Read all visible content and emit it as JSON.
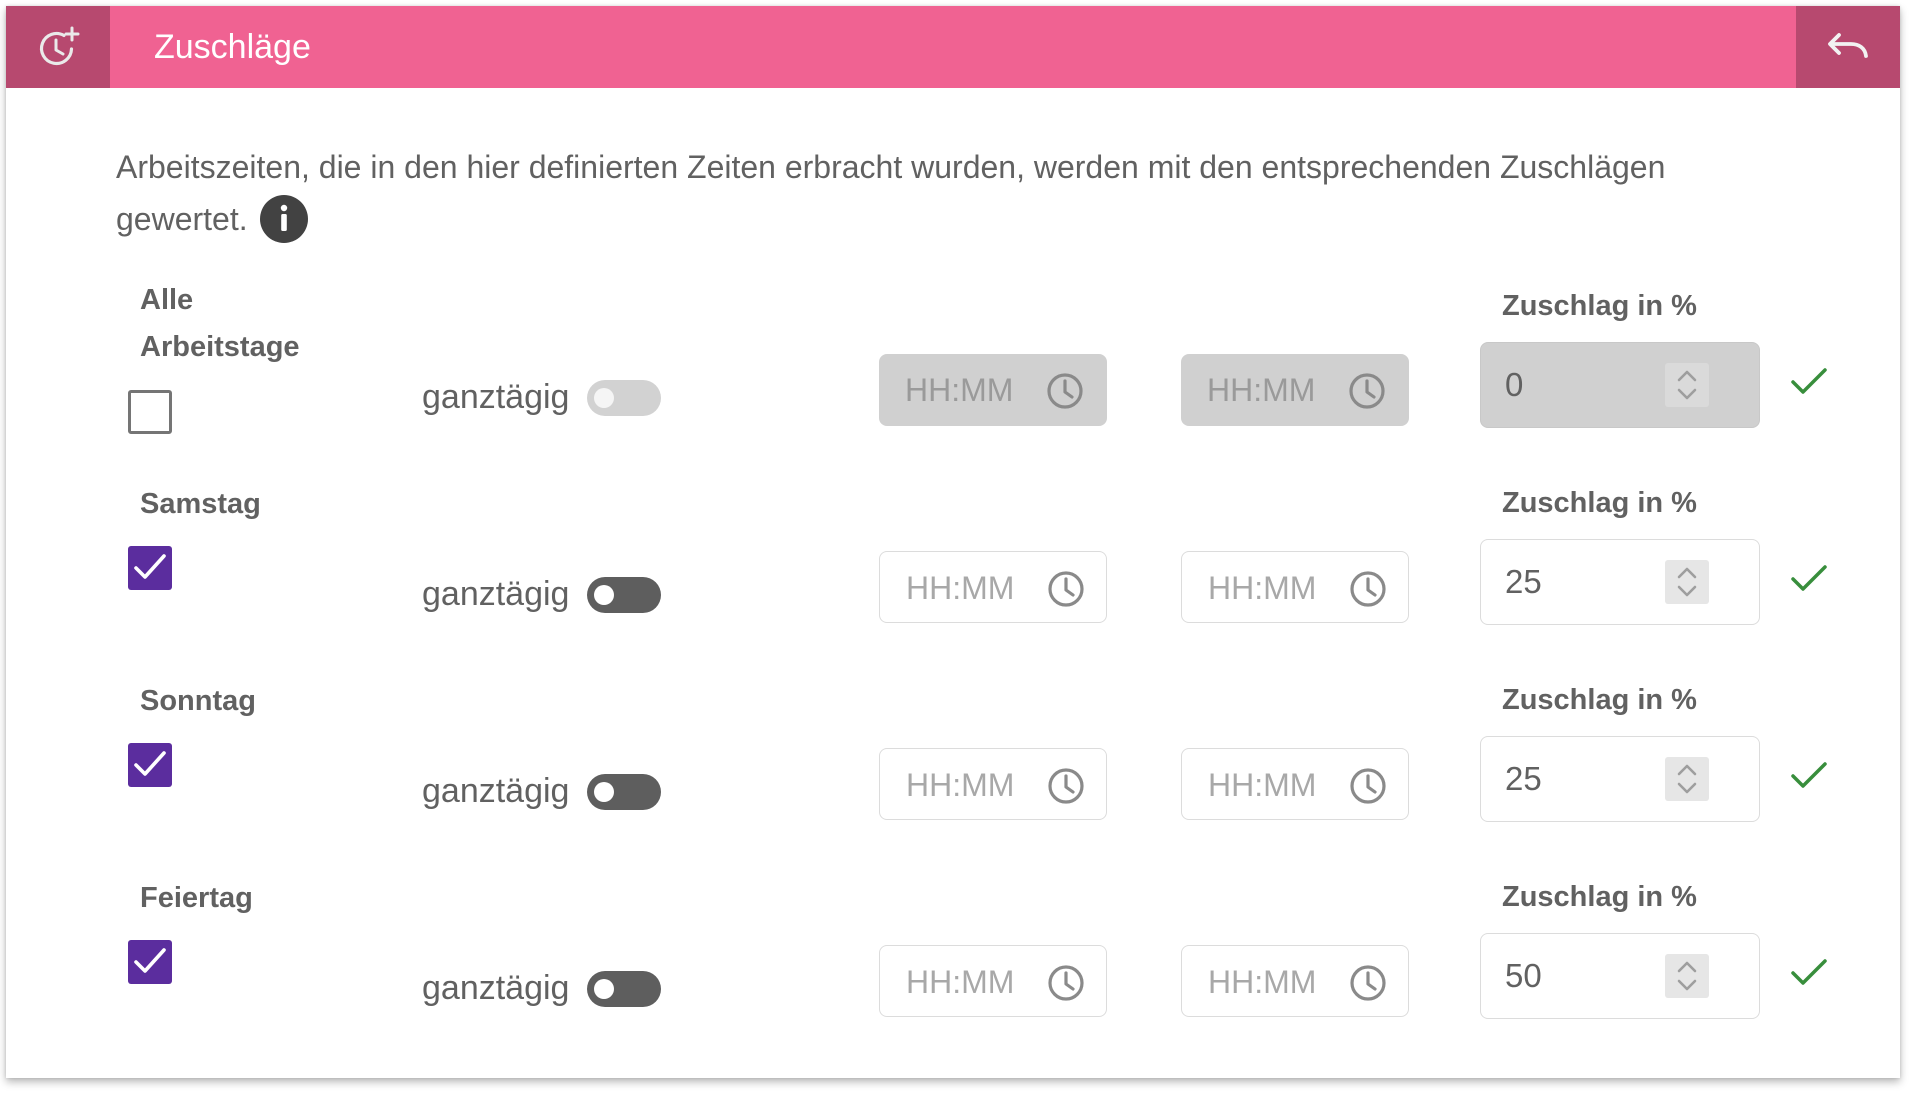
{
  "header": {
    "title": "Zuschläge",
    "left_icon": "history-add-icon",
    "right_icon": "undo-icon",
    "color": "#f06292",
    "icon_bg": "#b7496f"
  },
  "description": {
    "text": "Arbeitszeiten, die in den hier definierten Zeiten erbracht wurden, werden mit den entsprechenden Zuschlägen gewertet.",
    "info_icon": "info-icon"
  },
  "rows": [
    {
      "label": "Alle Arbeitstage",
      "checked": false,
      "ganztaegig_label": "ganztägig",
      "ganztaegig_on": false,
      "disabled": true,
      "start_placeholder": "HH:MM",
      "end_placeholder": "HH:MM",
      "zuschlag_label": "Zuschlag in %",
      "zuschlag_value": "0"
    },
    {
      "label": "Samstag",
      "checked": true,
      "ganztaegig_label": "ganztägig",
      "ganztaegig_on": false,
      "disabled": false,
      "start_placeholder": "HH:MM",
      "end_placeholder": "HH:MM",
      "zuschlag_label": "Zuschlag in %",
      "zuschlag_value": "25"
    },
    {
      "label": "Sonntag",
      "checked": true,
      "ganztaegig_label": "ganztägig",
      "ganztaegig_on": false,
      "disabled": false,
      "start_placeholder": "HH:MM",
      "end_placeholder": "HH:MM",
      "zuschlag_label": "Zuschlag in %",
      "zuschlag_value": "25"
    },
    {
      "label": "Feiertag",
      "checked": true,
      "ganztaegig_label": "ganztägig",
      "ganztaegig_on": false,
      "disabled": false,
      "start_placeholder": "HH:MM",
      "end_placeholder": "HH:MM",
      "zuschlag_label": "Zuschlag in %",
      "zuschlag_value": "50"
    }
  ],
  "colors": {
    "checkbox_checked": "#5b2d9e",
    "valid_check": "#388e3c",
    "text": "#616161"
  }
}
